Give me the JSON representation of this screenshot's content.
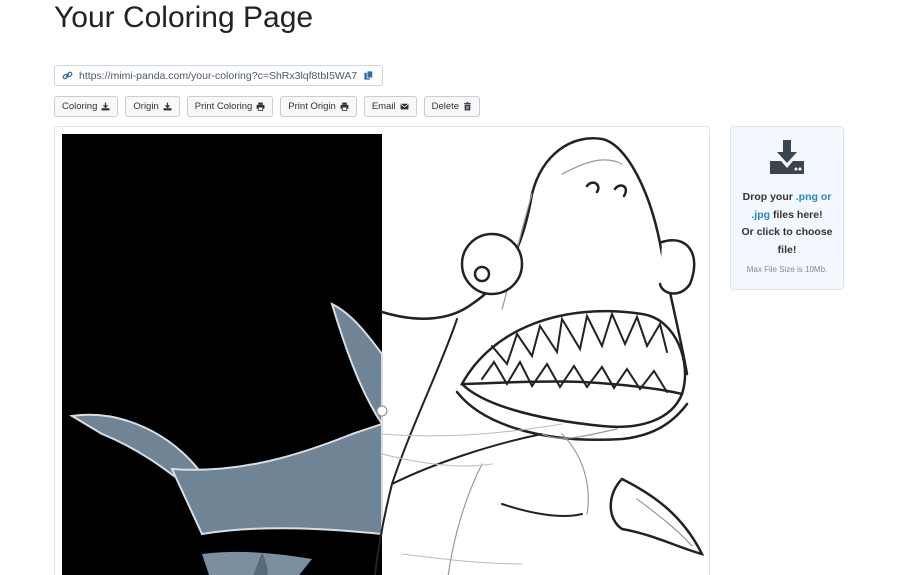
{
  "page": {
    "title": "Your Coloring Page"
  },
  "share": {
    "url": "https://mimi-panda.com/your-coloring?c=ShRx3lqf8tbI5WA7",
    "link_icon": "link-icon",
    "copy_icon": "copy-icon"
  },
  "toolbar": {
    "buttons": [
      {
        "label": "Coloring",
        "icon": "download-icon"
      },
      {
        "label": "Origin",
        "icon": "download-icon"
      },
      {
        "label": "Print Coloring",
        "icon": "print-icon"
      },
      {
        "label": "Print Origin",
        "icon": "print-icon"
      },
      {
        "label": "Email",
        "icon": "envelope-icon"
      },
      {
        "label": "Delete",
        "icon": "trash-icon"
      }
    ]
  },
  "upload": {
    "icon": "download-tray-icon",
    "line1_a": "Drop your ",
    "line1_png": ".png or",
    "line2_jpg": ".jpg",
    "line2_b": " files here!",
    "line3": "Or click to choose",
    "line4": "file!",
    "max_size": "Max File Size is 10Mb."
  },
  "colors": {
    "accent": "#2a87c8",
    "canvas_left_bg": "#000000",
    "shark_fill": "#6f8596"
  }
}
